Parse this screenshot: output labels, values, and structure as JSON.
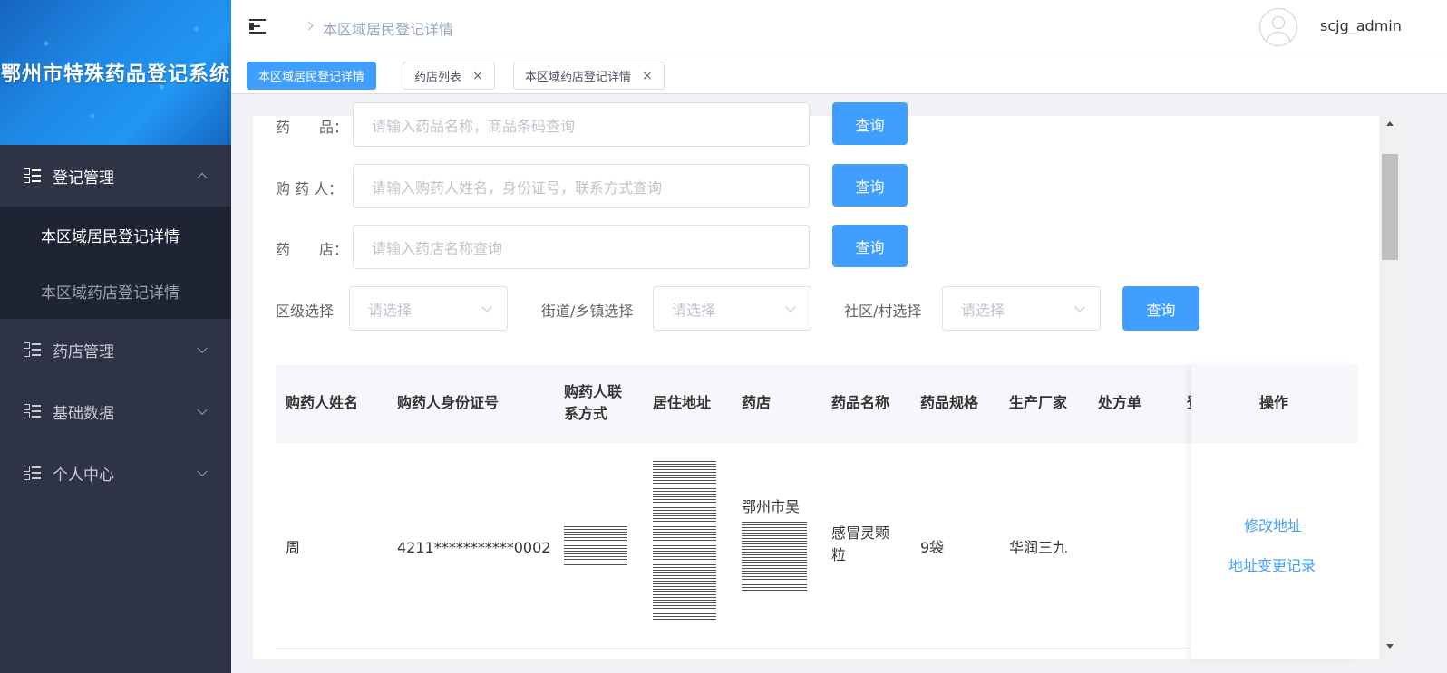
{
  "app": {
    "title": "鄂州市特殊药品登记系统"
  },
  "sidebar": {
    "items": [
      {
        "label": "登记管理",
        "expanded": true,
        "children": [
          {
            "label": "本区域居民登记详情",
            "active": true
          },
          {
            "label": "本区域药店登记详情",
            "active": false
          }
        ]
      },
      {
        "label": "药店管理",
        "expanded": false
      },
      {
        "label": "基础数据",
        "expanded": false
      },
      {
        "label": "个人中心",
        "expanded": false
      }
    ]
  },
  "header": {
    "breadcrumb": "本区域居民登记详情",
    "username": "scjg_admin"
  },
  "tags": [
    {
      "label": "本区域居民登记详情",
      "active": true,
      "closable": false
    },
    {
      "label": "药店列表",
      "active": false,
      "closable": true
    },
    {
      "label": "本区域药店登记详情",
      "active": false,
      "closable": true
    }
  ],
  "filters": {
    "drug": {
      "label": "药　　品：",
      "placeholder": "请输入药品名称，商品条码查询",
      "button": "查询"
    },
    "buyer": {
      "label": "购 药 人：",
      "placeholder": "请输入购药人姓名，身份证号，联系方式查询",
      "button": "查询"
    },
    "store": {
      "label": "药　　店：",
      "placeholder": "请输入药店名称查询",
      "button": "查询"
    },
    "district": {
      "label": "区级选择",
      "placeholder": "请选择"
    },
    "street": {
      "label": "街道/乡镇选择",
      "placeholder": "请选择"
    },
    "community": {
      "label": "社区/村选择",
      "placeholder": "请选择"
    },
    "region_button": "查询"
  },
  "table": {
    "columns": [
      "购药人姓名",
      "购药人身份证号",
      "购药人联系方式",
      "居住地址",
      "药店",
      "药品名称",
      "药品规格",
      "生产厂家",
      "处方单",
      "登",
      "操作"
    ],
    "rows": [
      {
        "name": "周",
        "id_number": "4211***********0002",
        "phone": "",
        "address": "",
        "store": "鄂州市吴",
        "drug_name": "感冒灵颗粒",
        "spec": "9袋",
        "manufacturer": "华润三九",
        "prescription": "",
        "actions": [
          "修改地址",
          "地址变更记录"
        ]
      }
    ]
  },
  "colors": {
    "accent": "#409eff",
    "sidebar": "#2e3346",
    "submenu": "#1f2434"
  }
}
